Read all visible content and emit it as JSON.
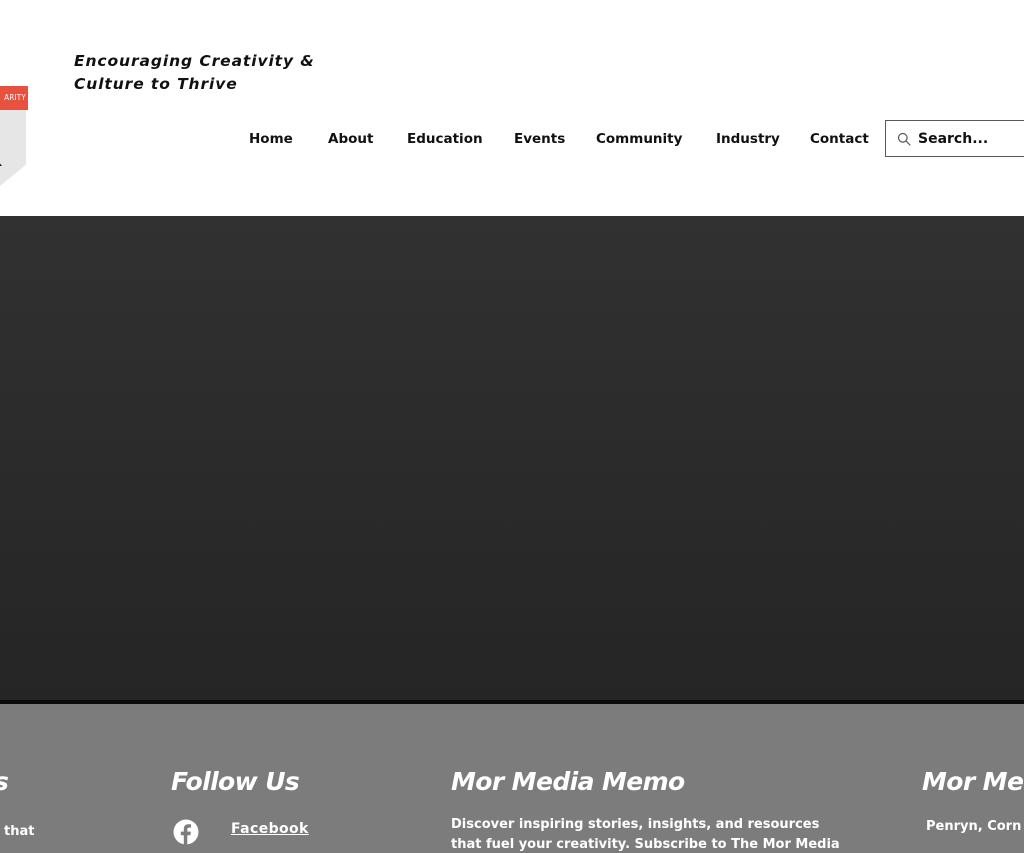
{
  "header": {
    "logo_banner_text": "ARITY",
    "tagline_line1": "Encouraging Creativity &",
    "tagline_line2": "Culture to Thrive"
  },
  "nav": {
    "items": [
      {
        "label": "Home"
      },
      {
        "label": "About"
      },
      {
        "label": "Education"
      },
      {
        "label": "Events"
      },
      {
        "label": "Community"
      },
      {
        "label": "Industry"
      },
      {
        "label": "Contact"
      }
    ]
  },
  "search": {
    "placeholder": "Search...",
    "icon": "search-icon"
  },
  "footer": {
    "col1": {
      "heading_fragment": "s",
      "text_fragment": "that"
    },
    "follow": {
      "heading": "Follow Us",
      "facebook_label": "Facebook",
      "facebook_icon": "facebook-icon"
    },
    "memo": {
      "heading": "Mor Media Memo",
      "line1": "Discover inspiring stories, insights, and resources",
      "line2": "that fuel your creativity. Subscribe to The Mor Media"
    },
    "contact": {
      "heading_fragment": "Mor Med",
      "address_fragment": "Penryn, Corn"
    }
  },
  "colors": {
    "accent": "#e8513d",
    "hero_bg": "#2b2b2b",
    "footer_bg": "#7c7c7c",
    "text_dark": "#111111",
    "text_light": "#ffffff"
  }
}
